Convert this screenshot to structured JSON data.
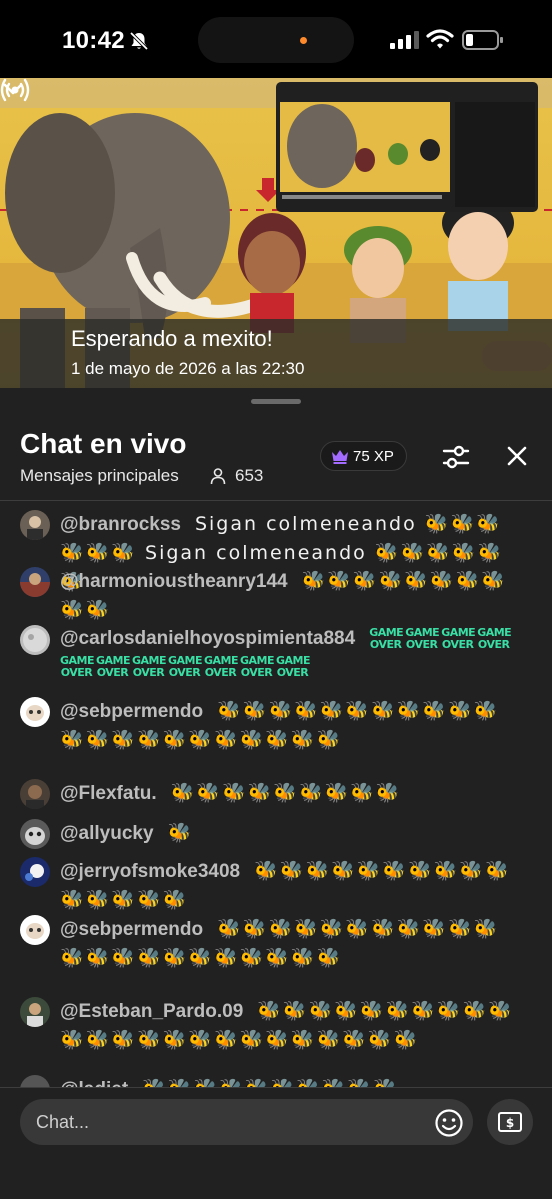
{
  "status_bar": {
    "time": "10:42"
  },
  "video": {
    "title": "Esperando a mexito!",
    "schedule": "1 de mayo de 2026 a las 22:30"
  },
  "chat": {
    "title": "Chat en vivo",
    "mode": "Mensajes principales",
    "viewer_count": "653",
    "xp": "75 XP",
    "input_placeholder": "Chat..."
  },
  "messages": [
    {
      "author": "@branrockss",
      "text": "Sigan colmeneando 🐝🐝🐝🐝🐝🐝 Sigan colmeneando 🐝🐝🐝🐝🐝🐝"
    },
    {
      "author": "@harmonioustheanry144",
      "text": "🐝🐝🐝🐝🐝🐝🐝🐝🐝🐝"
    },
    {
      "author": "@carlosdanielhoyospimienta884",
      "text": "",
      "emote": "GAME OVER",
      "emote_count": 11
    },
    {
      "author": "@sebpermendo",
      "text": "🐝🐝🐝🐝🐝🐝🐝🐝🐝🐝🐝🐝🐝🐝🐝🐝🐝🐝🐝🐝🐝🐝"
    },
    {
      "author": "@Flexfatu.",
      "text": "🐝🐝🐝🐝🐝🐝🐝🐝🐝"
    },
    {
      "author": "@allyucky",
      "text": "🐝"
    },
    {
      "author": "@jerryofsmoke3408",
      "text": "🐝🐝🐝🐝🐝🐝🐝🐝🐝🐝🐝🐝🐝🐝🐝"
    },
    {
      "author": "@sebpermendo",
      "text": "🐝🐝🐝🐝🐝🐝🐝🐝🐝🐝🐝🐝🐝🐝🐝🐝🐝🐝🐝🐝🐝🐝"
    },
    {
      "author": "@Esteban_Pardo.09",
      "text": "🐝🐝🐝🐝🐝🐝🐝🐝🐝🐝🐝🐝🐝🐝🐝🐝🐝🐝🐝🐝🐝🐝🐝🐝"
    },
    {
      "author": "@ladiet",
      "text": "🐝🐝🐝🐝🐝🐝🐝🐝🐝🐝"
    }
  ],
  "icons": {
    "collapse": "chevron-down-icon",
    "live": "live-broadcast-icon",
    "viewers": "person-icon",
    "xp": "crown-icon",
    "filter": "sliders-icon",
    "close": "close-icon",
    "emoji": "smiley-icon",
    "superchat": "dollar-bill-icon"
  },
  "colors": {
    "background": "#212121",
    "xp_crown": "#a36bff",
    "game_over_emote": "#38e0a6"
  }
}
